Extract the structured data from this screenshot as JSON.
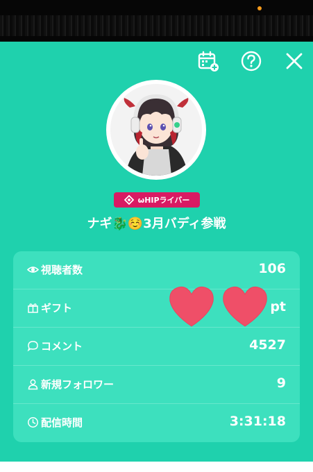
{
  "header": {
    "calendar_icon": "calendar-add-icon",
    "help_icon": "question-circle-icon",
    "close_icon": "close-x-icon"
  },
  "profile": {
    "badge": "ωHIPライバー",
    "name": "ナギ🐉☺️3月バディ参戦"
  },
  "stats": [
    {
      "icon": "eye-icon",
      "label": "視聴者数",
      "value": "106"
    },
    {
      "icon": "gift-icon",
      "label": "ギフト",
      "value": "pt"
    },
    {
      "icon": "comment-icon",
      "label": "コメント",
      "value": "4527"
    },
    {
      "icon": "person-icon",
      "label": "新規フォロワー",
      "value": "9"
    },
    {
      "icon": "clock-icon",
      "label": "配信時間",
      "value": "3:31:18"
    }
  ],
  "colors": {
    "panel": "#1fd1ad",
    "stats_card": "#3de0be",
    "badge": "#d91a63",
    "heart": "#ef4f68"
  }
}
